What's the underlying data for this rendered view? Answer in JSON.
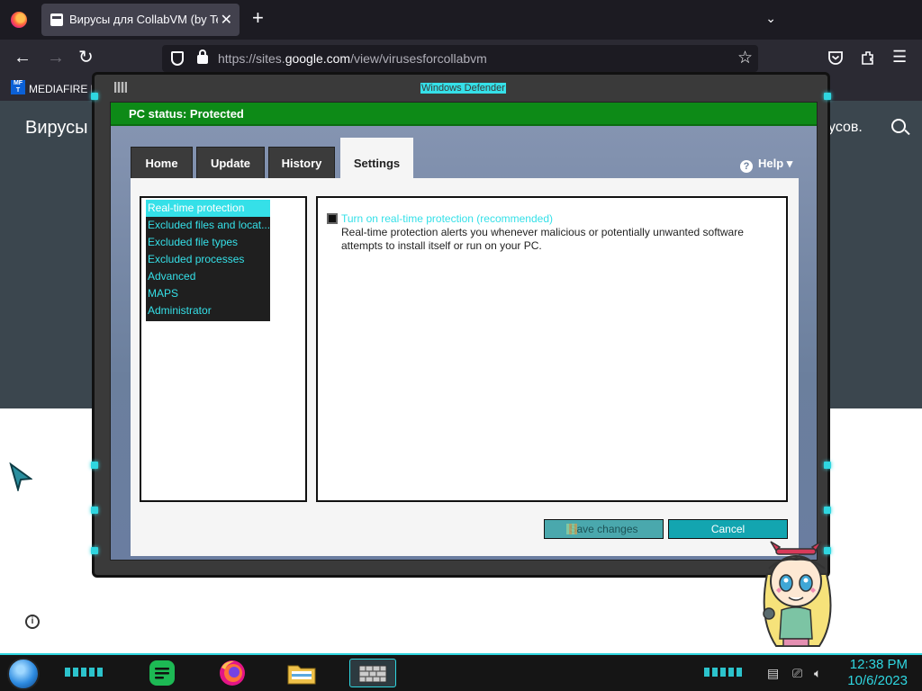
{
  "browser": {
    "tab_title": "Вирусы для CollabVM (by TestUser)",
    "tab_close": "✕",
    "new_tab": "+",
    "tab_list": "⌄",
    "url_prefix": "https://sites.",
    "url_domain": "google.com",
    "url_path": "/view/virusesforcollabvm",
    "bookmark_icon_text": "MF T",
    "bookmark_label": "MEDIAFIRE R"
  },
  "webpage": {
    "title": "Вирусы",
    "title_right": "усов.",
    "info_icon": "i"
  },
  "defender": {
    "window_title": "Windows Defender",
    "status": "PC status: Protected",
    "tabs": [
      {
        "label": "Home"
      },
      {
        "label": "Update"
      },
      {
        "label": "History"
      },
      {
        "label": "Settings"
      }
    ],
    "active_tab": "Settings",
    "help_label": "Help ▾",
    "help_icon": "?",
    "sidebar": [
      {
        "label": "Real-time protection"
      },
      {
        "label": "Excluded files and locat..."
      },
      {
        "label": "Excluded file types"
      },
      {
        "label": "Excluded processes"
      },
      {
        "label": "Advanced"
      },
      {
        "label": "MAPS"
      },
      {
        "label": "Administrator"
      }
    ],
    "selected_sidebar": "Real-time protection",
    "option_label": "Turn on real-time protection (recommended)",
    "option_checked": true,
    "option_description": "Real-time protection alerts you whenever malicious or potentially unwanted software attempts to install itself or run on your PC.",
    "save_button": "Save changes",
    "cancel_button": "Cancel"
  },
  "taskbar": {
    "time": "12:38 PM",
    "date": "10/6/2023",
    "apps": [
      {
        "icon": "notes-app-icon"
      },
      {
        "icon": "firefox-icon"
      },
      {
        "icon": "file-explorer-icon"
      },
      {
        "icon": "windows-defender-icon"
      }
    ]
  },
  "colors": {
    "accent_cyan": "#35e0e8",
    "status_green": "#0d8a17",
    "browser_dark": "#1c1b22"
  }
}
